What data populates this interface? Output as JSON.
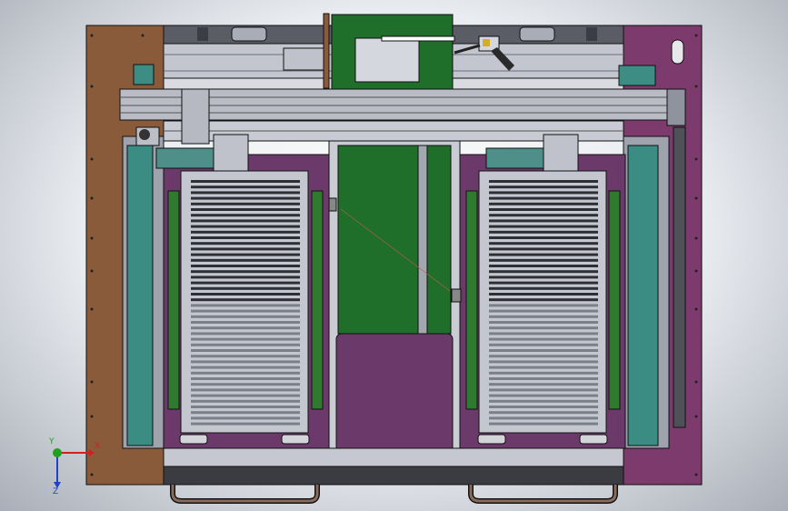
{
  "scene": {
    "description_colors": {
      "background": "#e7eaee",
      "frame_brown": "#8a5a3a",
      "frame_purple": "#7a3a6a",
      "panel_purple": "#6b3a6a",
      "steel": "#b8bcc6",
      "steel_dark": "#6a6e78",
      "pcb_green": "#1f6e2a",
      "rail_teal": "#3d8d84",
      "cylinder_teal": "#4f8f8a",
      "black": "#121212",
      "rubber_handle": "#8a6a5a"
    }
  },
  "triad": {
    "x_label": "X",
    "y_label": "Y",
    "z_label": "Z",
    "x_color": "#d02020",
    "y_color": "#20a020",
    "z_color": "#2040d0"
  }
}
